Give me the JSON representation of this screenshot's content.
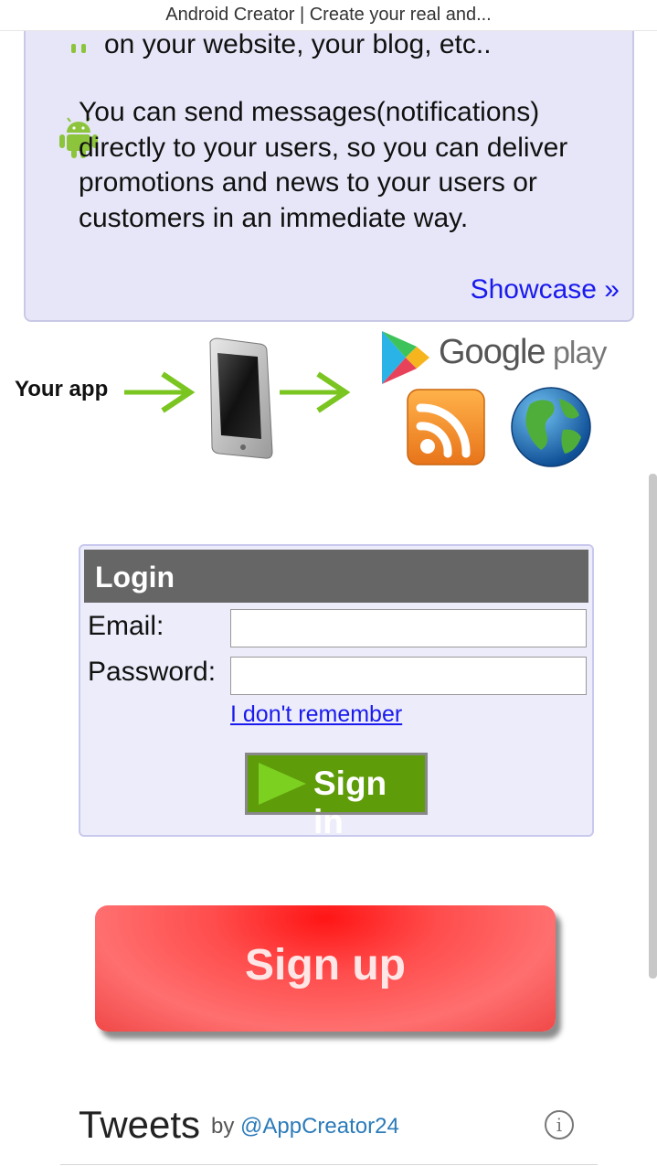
{
  "browser": {
    "title": "Android Creator | Create your real and..."
  },
  "features": {
    "line1": "on your website, your blog, etc..",
    "para2": "You can send messages(notifications) directly to your users, so you can deliver promotions and news to your users or customers in an immediate way.",
    "showcase_link": "Showcase »",
    "bullet_icon": "android-icon"
  },
  "promo": {
    "your_app_label": "Your app",
    "store_label_main": "Google",
    "store_label_sub": " play",
    "icons": [
      "arrow-right-icon",
      "phone-icon",
      "google-play-icon",
      "rss-icon",
      "globe-icon"
    ],
    "colors": {
      "arrow": "#7ac520",
      "rss": "#f28a1e",
      "globe_ocean": "#1f78c8",
      "globe_land": "#4fae3a"
    }
  },
  "login": {
    "header": "Login",
    "email_label": "Email:",
    "email_value": "",
    "password_label": "Password:",
    "password_value": "",
    "forgot_link": "I don't remember",
    "signin_label": "Sign in"
  },
  "signup": {
    "label": "Sign up",
    "color": "#ff3b3b"
  },
  "tweets": {
    "title": "Tweets",
    "by": "by ",
    "handle": "@AppCreator24"
  }
}
